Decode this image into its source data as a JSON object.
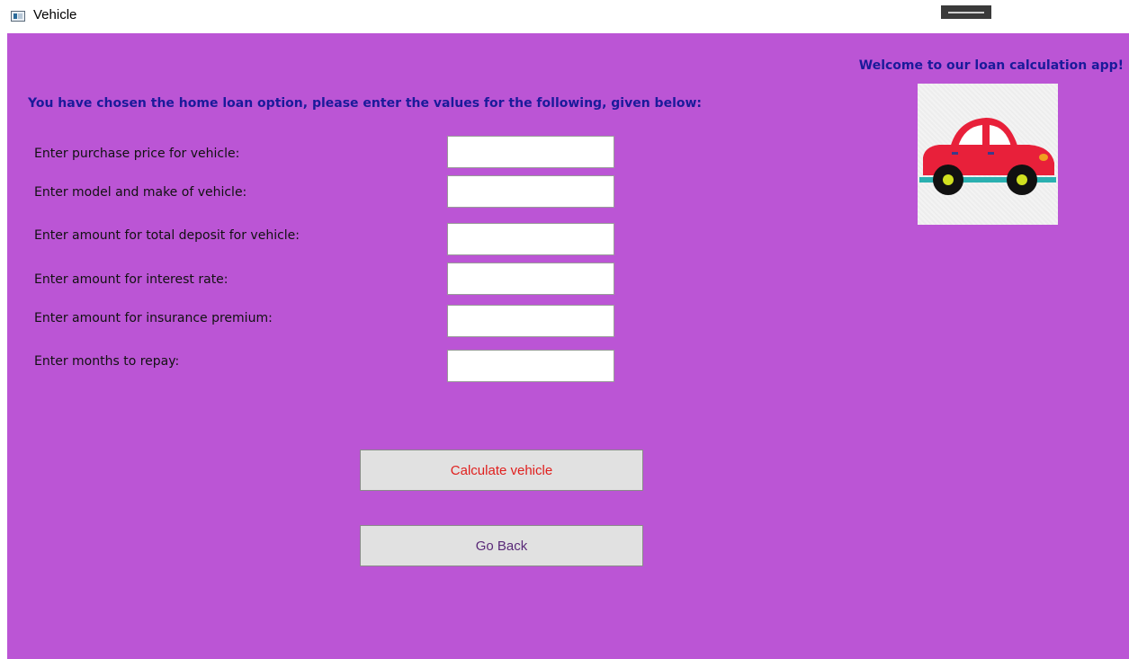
{
  "window": {
    "title": "Vehicle",
    "icon": "app-window-icon"
  },
  "header": {
    "welcome": "Welcome to our loan calculation app!",
    "instruction": "You have chosen the home loan option, please enter the values for the following, given below:"
  },
  "image": {
    "subject": "red-car-illustration"
  },
  "form": {
    "fields": [
      {
        "label": "Enter purchase price for vehicle:",
        "value": ""
      },
      {
        "label": "Enter model and make of vehicle:",
        "value": ""
      },
      {
        "label": "Enter amount for total deposit for vehicle:",
        "value": ""
      },
      {
        "label": "Enter amount for interest rate:",
        "value": ""
      },
      {
        "label": "Enter amount for insurance premium:",
        "value": ""
      },
      {
        "label": "Enter months to repay:",
        "value": ""
      }
    ]
  },
  "buttons": {
    "calculate": "Calculate vehicle",
    "back": "Go Back"
  },
  "colors": {
    "background": "#bb55d5",
    "heading": "#1a1a9a",
    "calculate_text": "#e0201e",
    "back_text": "#5a2a78",
    "button_face": "#e1e1e1"
  }
}
